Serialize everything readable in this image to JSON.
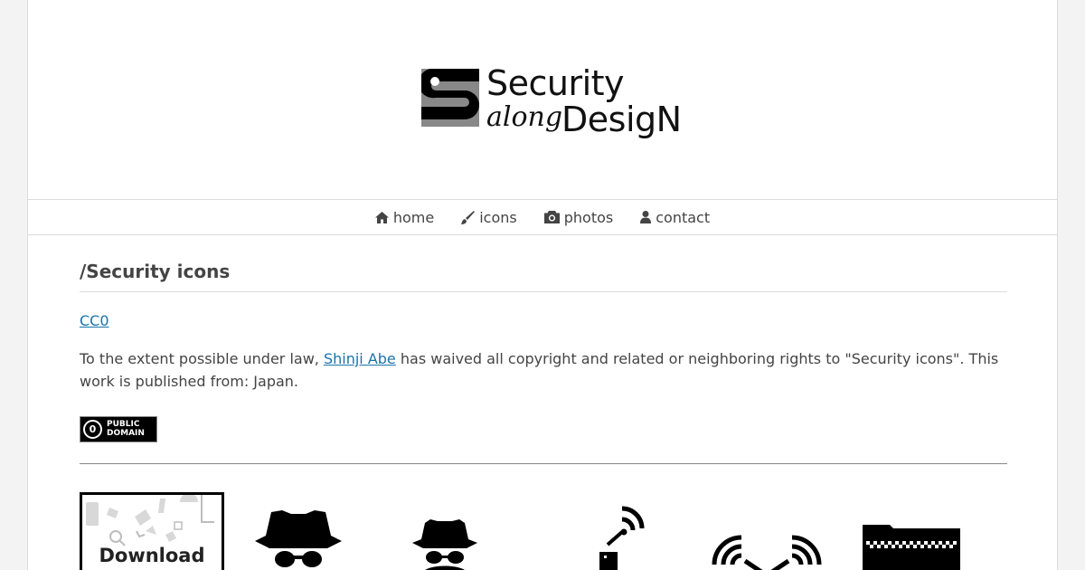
{
  "header": {
    "logo": {
      "line1": "Security",
      "line2_script": "along",
      "line2": "DesigN"
    }
  },
  "nav": {
    "items": [
      {
        "label": "home",
        "icon": "home-icon"
      },
      {
        "label": "icons",
        "icon": "brush-icon"
      },
      {
        "label": "photos",
        "icon": "camera-icon"
      },
      {
        "label": "contact",
        "icon": "user-icon"
      }
    ]
  },
  "main": {
    "title": "/Security icons",
    "license_link": "CC0",
    "waiver": {
      "before": "To the extent possible under law, ",
      "author": "Shinji Abe",
      "after": " has waived all copyright and related or neighboring rights to \"Security icons\". This work is published from: Japan."
    },
    "badge": {
      "symbol": "0",
      "line1": "PUBLIC",
      "line2": "DOMAIN"
    }
  },
  "gallery": {
    "download_label": "Download All i",
    "icons": [
      "spy-hat-icon",
      "spy-agent-icon",
      "radio-transmitter-icon",
      "wireless-signal-icon",
      "folder-icon"
    ]
  },
  "colors": {
    "link": "#1a73a8",
    "text": "#444444",
    "border": "#dcdcdc"
  }
}
